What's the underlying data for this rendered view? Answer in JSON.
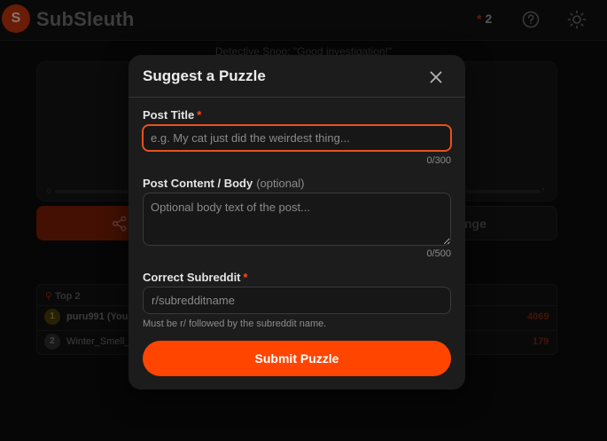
{
  "app": {
    "logo_letter": "S",
    "name": "SubSleuth",
    "streak_count": "2",
    "accent_color": "#ff4500"
  },
  "background": {
    "detective_message": "Detective Snoo: \"Good investigation!\"",
    "progress_min": "0",
    "progress_max": "7",
    "challenge_label": "nge",
    "leaderboard": {
      "title": "Top 2",
      "rows": [
        {
          "rank": "1",
          "user": "puru991 (You)",
          "score": "4069"
        },
        {
          "rank": "2",
          "user": "Winter_Smell_",
          "score": "179"
        }
      ]
    }
  },
  "modal": {
    "title": "Suggest a Puzzle",
    "post_title": {
      "label": "Post Title",
      "required_mark": "*",
      "placeholder": "e.g. My cat just did the weirdest thing...",
      "value": "",
      "counter": "0/300"
    },
    "post_body": {
      "label": "Post Content / Body",
      "optional_tag": "(optional)",
      "placeholder": "Optional body text of the post...",
      "value": "",
      "counter": "0/500"
    },
    "subreddit": {
      "label": "Correct Subreddit",
      "required_mark": "*",
      "placeholder": "r/subredditname",
      "value": "",
      "hint": "Must be r/ followed by the subreddit name."
    },
    "submit_label": "Submit Puzzle"
  }
}
